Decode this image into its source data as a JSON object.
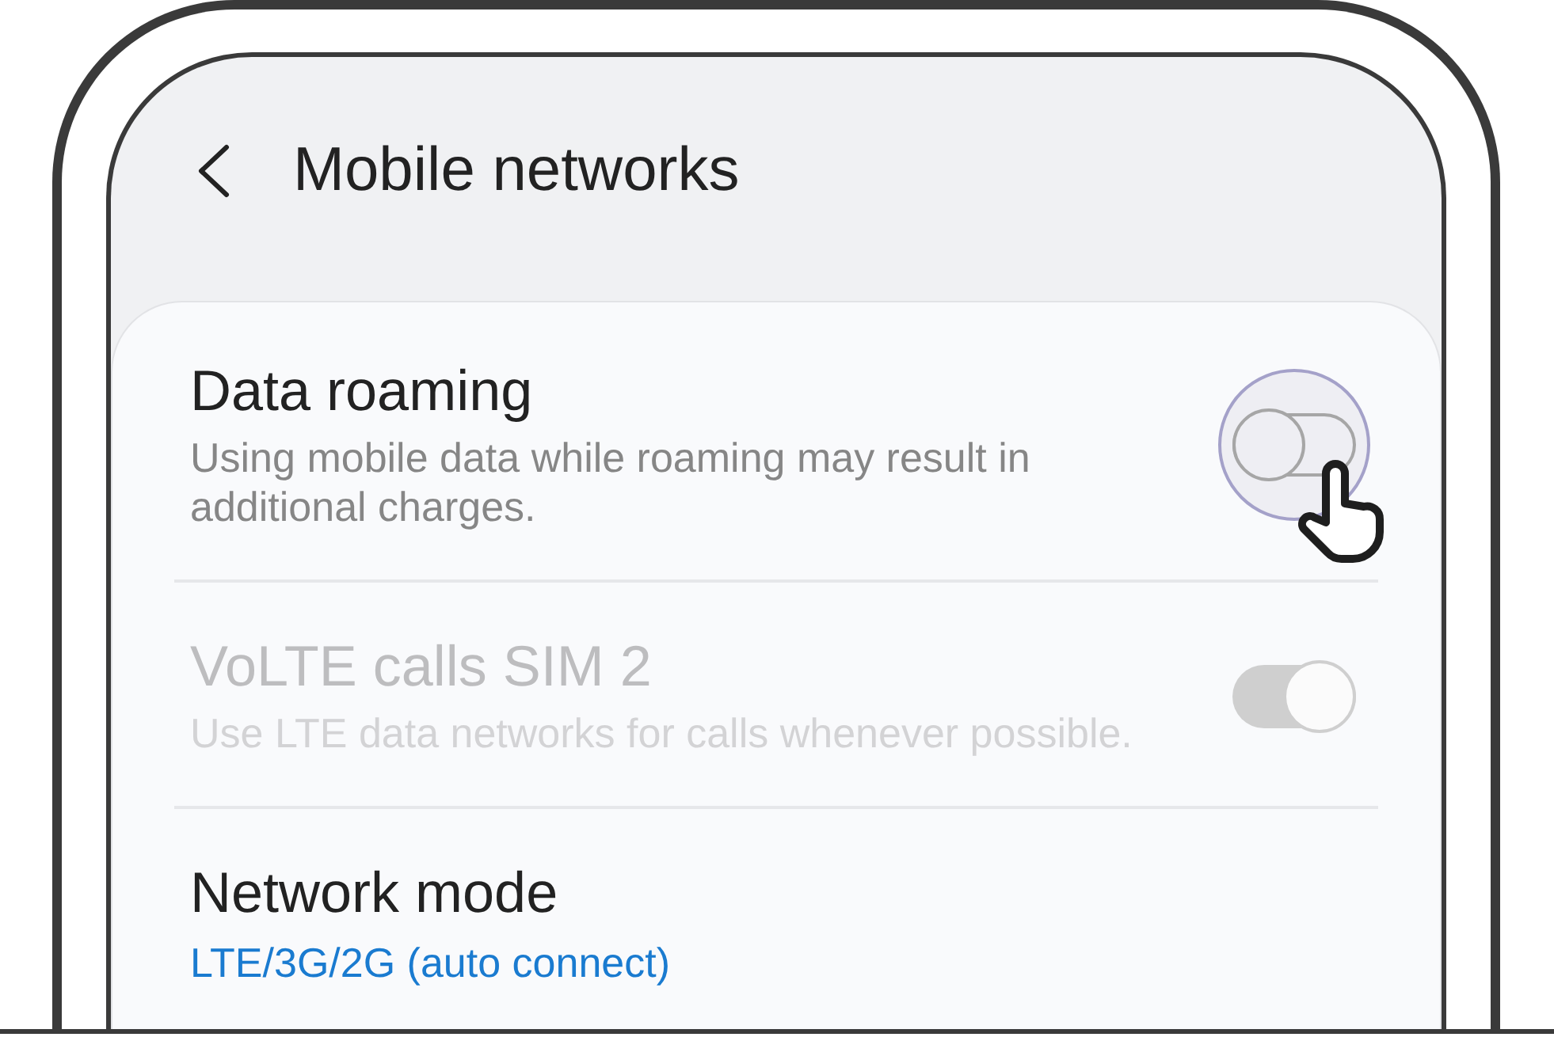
{
  "screen": {
    "title": "Mobile networks"
  },
  "items": [
    {
      "kind": "toggle",
      "title": "Data roaming",
      "description": "Using mobile data while roaming may result in additional charges.",
      "on": false,
      "disabled": false,
      "pressed": true
    },
    {
      "kind": "toggle",
      "title": "VoLTE calls SIM 2",
      "description": "Use LTE data networks for calls whenever possible.",
      "on": true,
      "disabled": true,
      "pressed": false
    },
    {
      "kind": "value",
      "title": "Network mode",
      "value": "LTE/3G/2G (auto connect)"
    }
  ]
}
